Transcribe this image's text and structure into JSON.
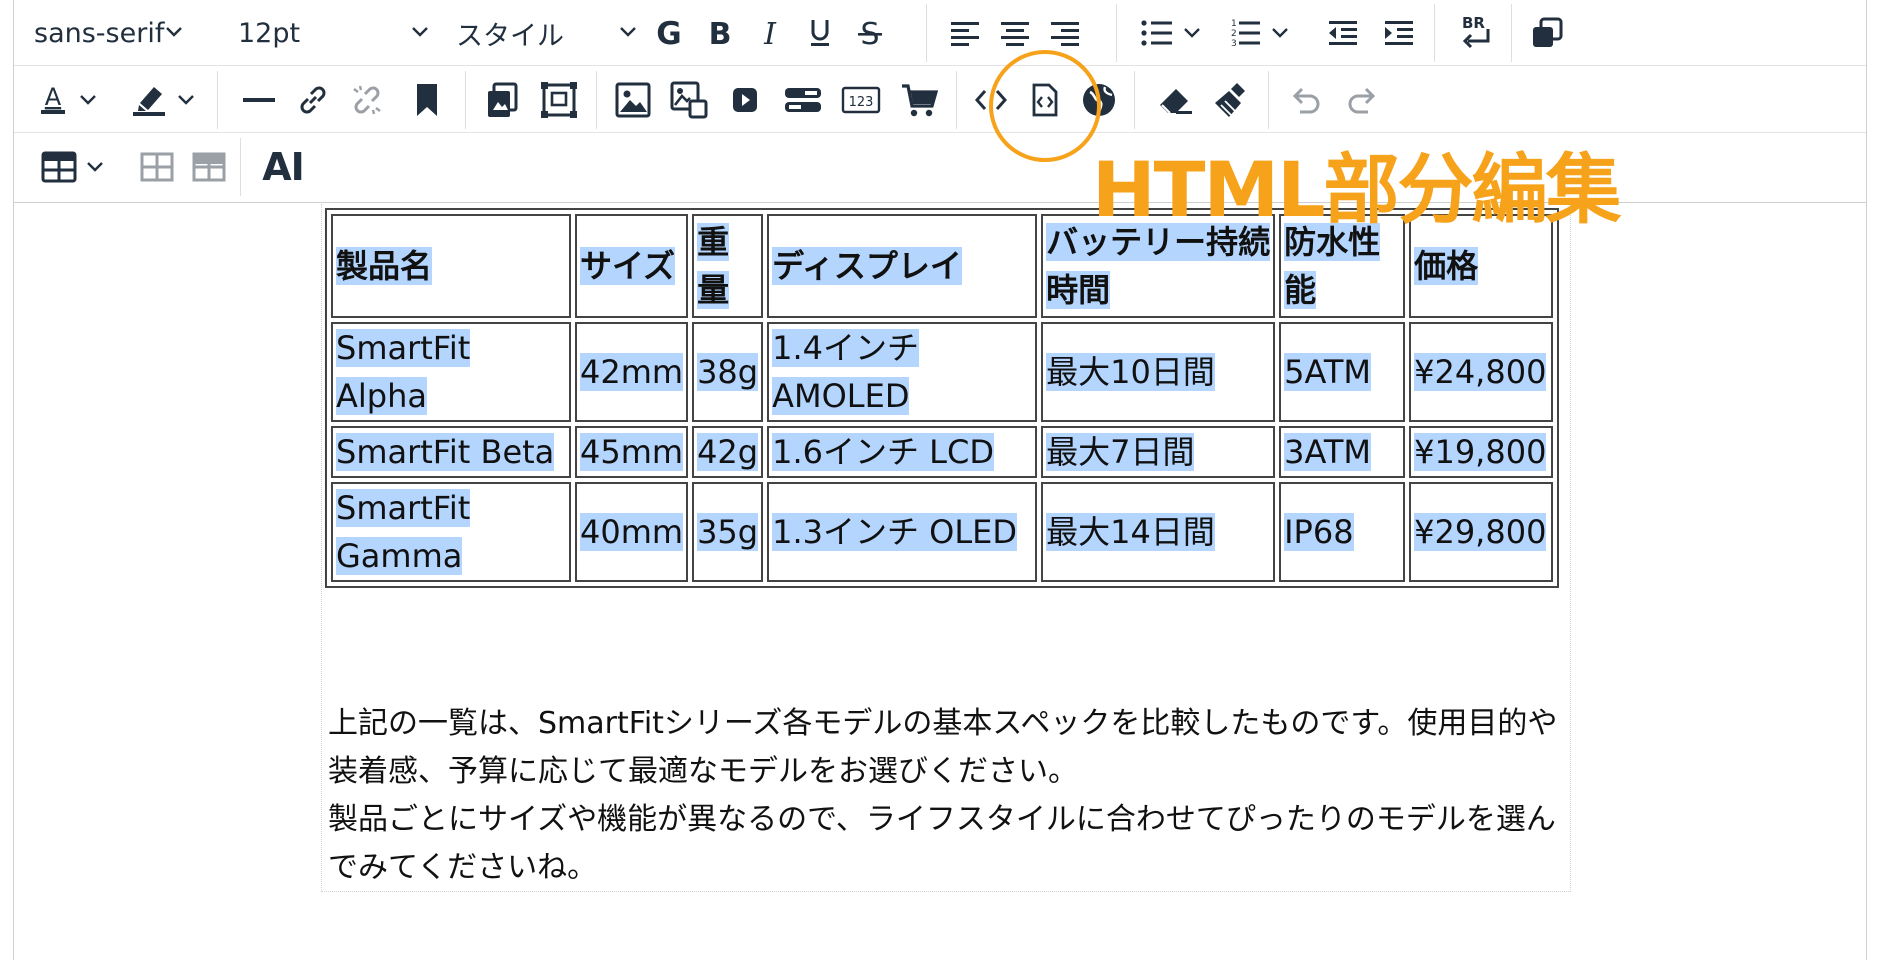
{
  "toolbar": {
    "font_family": "sans-serif",
    "font_size": "12pt",
    "style": "スタイル",
    "ai_label": "AI",
    "br_label": "BR",
    "counter_label": "123"
  },
  "annotation": {
    "label": "HTML部分編集",
    "color": "#f6a21a"
  },
  "table": {
    "headers": [
      "製品名",
      "サイズ",
      "重量",
      "ディスプレイ",
      "バッテリー持続時間",
      "防水性能",
      "価格"
    ],
    "rows": [
      [
        "SmartFit Alpha",
        "42mm",
        "38g",
        "1.4インチ AMOLED",
        "最大10日間",
        "5ATM",
        "¥24,800"
      ],
      [
        "SmartFit Beta",
        "45mm",
        "42g",
        "1.6インチ LCD",
        "最大7日間",
        "3ATM",
        "¥19,800"
      ],
      [
        "SmartFit Gamma",
        "40mm",
        "35g",
        "1.3インチ OLED",
        "最大14日間",
        "IP68",
        "¥29,800"
      ]
    ]
  },
  "paragraph": {
    "line1": "上記の一覧は、SmartFitシリーズ各モデルの基本スペックを比較したものです。使用目的や装着感、予算に応じて最適なモデルをお選びください。",
    "line2": "製品ごとにサイズや機能が異なるので、ライフスタイルに合わせてぴったりのモデルを選んでみてくださいね。"
  },
  "colors": {
    "selection": "#b4d5fe",
    "icon": "#222f3e",
    "disabled_icon": "#9aa0a6"
  }
}
